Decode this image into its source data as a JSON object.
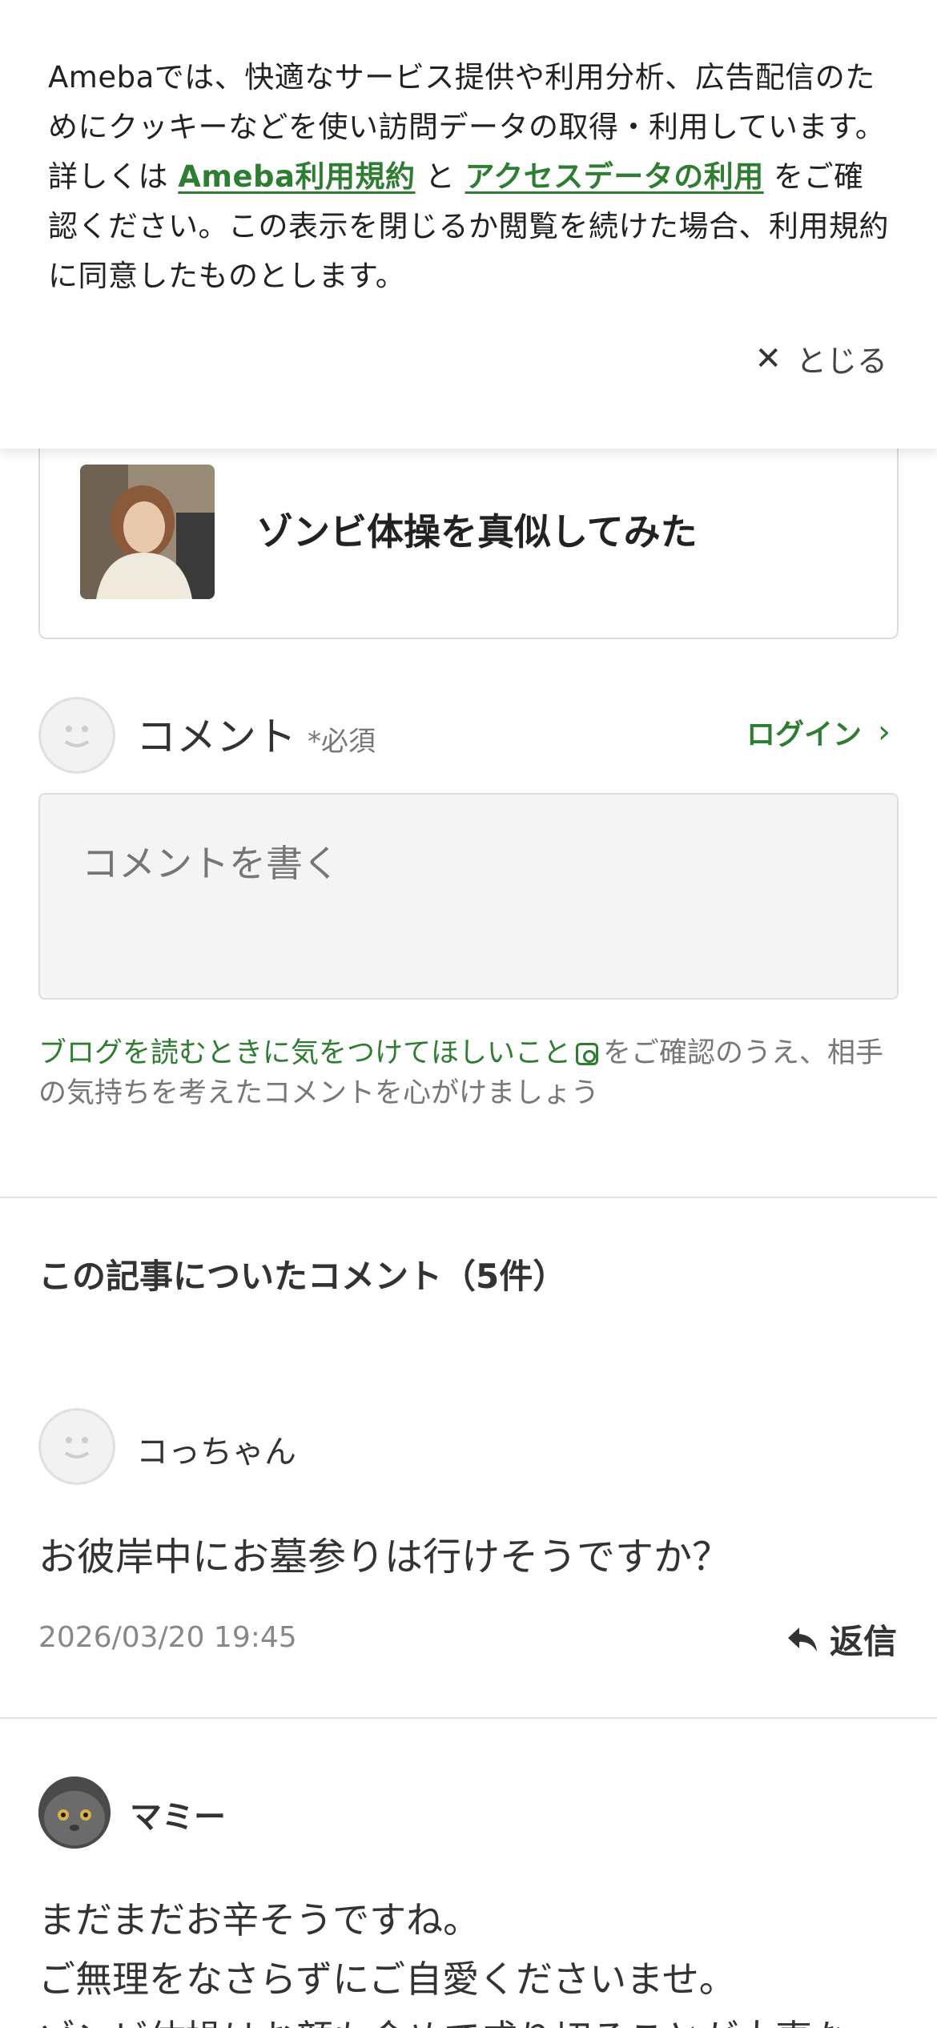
{
  "cookie_banner": {
    "text_part1": "Amebaでは、快適なサービス提供や利用分析、広告配信のためにクッキーなどを使い訪問データの取得・利用しています。詳しくは ",
    "link1": "Ameba利用規約",
    "text_part2": " と ",
    "link2": "アクセスデータの利用",
    "text_part3": " をご確認ください。この表示を閉じるか閲覧を続けた場合、利用規約に同意したものとします。",
    "close_label": "とじる"
  },
  "article": {
    "title": "ゾンビ体操を真似してみた"
  },
  "comment_form": {
    "label": "コメント",
    "required": "*必須",
    "login_label": "ログイン",
    "placeholder": "コメントを書く",
    "notice_link": "ブログを読むときに気をつけてほしいこと",
    "notice_text": "をご確認のうえ、相手の気持ちを考えたコメントを心がけましょう"
  },
  "comments_section": {
    "title": "この記事についたコメント（5件）",
    "comments": [
      {
        "author": "コっちゃん",
        "body": "お彼岸中にお墓参りは行けそうですか？",
        "date": "2026/03/20 19:45",
        "reply_label": "返信"
      },
      {
        "author": "マミー",
        "lines": [
          "まだまだお辛そうですね。",
          "ご無理をなさらずにご自愛くださいませ。",
          "ゾンビ体操はお顔も含めて成り切ることが大事な"
        ]
      }
    ]
  },
  "colors": {
    "accent_green": "#2e7d32",
    "text_main": "#333333",
    "text_muted": "#888888",
    "input_bg": "#f4f4f4"
  },
  "icons": {
    "close": "close-icon",
    "chevron": "chevron-right-icon",
    "reply": "reply-arrow-icon",
    "external": "external-link-icon"
  }
}
